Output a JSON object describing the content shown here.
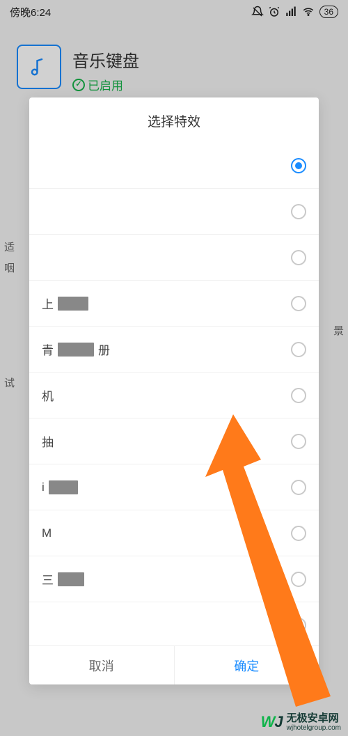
{
  "status_bar": {
    "time": "傍晚6:24",
    "battery": "36"
  },
  "background": {
    "app_title": "音乐键盘",
    "app_status": "已启用",
    "side_letters": {
      "a": "适",
      "b": "咽",
      "c": "试",
      "d": "景"
    }
  },
  "dialog": {
    "title": "选择特效",
    "selected_index": 0,
    "items": [
      {
        "prefix": "",
        "redact_w": 0,
        "suffix": ""
      },
      {
        "prefix": "",
        "redact_w": 0,
        "suffix": ""
      },
      {
        "prefix": "",
        "redact_w": 0,
        "suffix": ""
      },
      {
        "prefix": "上",
        "redact_w": 44,
        "suffix": ""
      },
      {
        "prefix": "青",
        "redact_w": 52,
        "suffix": "册"
      },
      {
        "prefix": "机",
        "redact_w": 0,
        "suffix": ""
      },
      {
        "prefix": "",
        "redact_w": 0,
        "suffix": "抽"
      },
      {
        "prefix": "i",
        "redact_w": 42,
        "suffix": ""
      },
      {
        "prefix": "M",
        "redact_w": 0,
        "suffix": ""
      },
      {
        "prefix": "三",
        "redact_w": 38,
        "suffix": ""
      },
      {
        "prefix": "",
        "redact_w": 0,
        "suffix": ""
      }
    ],
    "cancel": "取消",
    "ok": "确定"
  },
  "watermark": {
    "brand_cn": "无极安卓网",
    "brand_url": "wjhotelgroup.com"
  }
}
